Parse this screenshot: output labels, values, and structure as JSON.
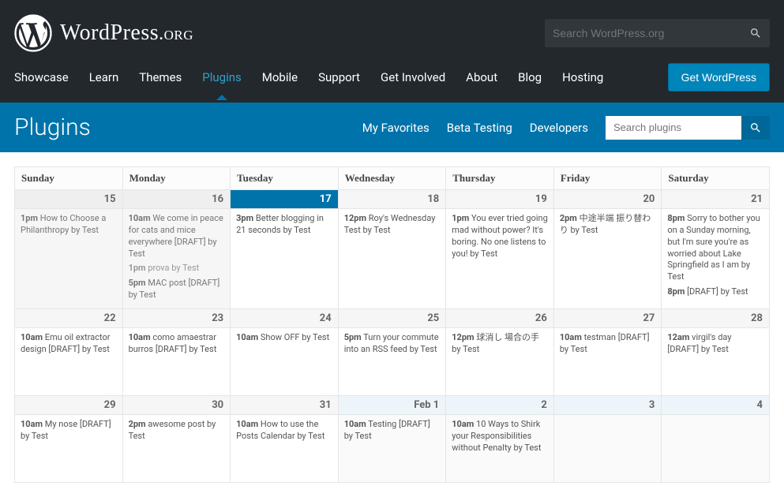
{
  "header": {
    "site_name": "WordPress",
    "site_tld": ".org",
    "search_placeholder": "Search WordPress.org",
    "download_label": "Get WordPress"
  },
  "nav": {
    "items": [
      {
        "label": "Showcase"
      },
      {
        "label": "Learn"
      },
      {
        "label": "Themes"
      },
      {
        "label": "Plugins",
        "active": true
      },
      {
        "label": "Mobile"
      },
      {
        "label": "Support"
      },
      {
        "label": "Get Involved"
      },
      {
        "label": "About"
      },
      {
        "label": "Blog"
      },
      {
        "label": "Hosting"
      }
    ]
  },
  "subheader": {
    "title": "Plugins",
    "links": [
      "My Favorites",
      "Beta Testing",
      "Developers"
    ],
    "search_placeholder": "Search plugins"
  },
  "calendar": {
    "day_headers": [
      "Sunday",
      "Monday",
      "Tuesday",
      "Wednesday",
      "Thursday",
      "Friday",
      "Saturday"
    ],
    "weeks": [
      [
        {
          "num": "15",
          "past": true,
          "events": [
            {
              "t": "1pm",
              "txt": "How to Choose a Philanthropy by Test"
            }
          ]
        },
        {
          "num": "16",
          "past": true,
          "events": [
            {
              "t": "10am",
              "txt": "We come in peace for cats and mice everywhere [DRAFT] by Test"
            },
            {
              "t": "1pm",
              "txt": "prova by Test",
              "dim": true
            },
            {
              "t": "5pm",
              "txt": "MAC post [DRAFT] by Test"
            }
          ]
        },
        {
          "num": "17",
          "today": true,
          "events": [
            {
              "t": "3pm",
              "txt": "Better blogging in 21 seconds by Test"
            }
          ]
        },
        {
          "num": "18",
          "events": [
            {
              "t": "12pm",
              "txt": "Roy's Wednesday Test by Test"
            }
          ]
        },
        {
          "num": "19",
          "events": [
            {
              "t": "1pm",
              "txt": "You ever tried going mad without power? It's boring. No one listens to you! by Test"
            }
          ]
        },
        {
          "num": "20",
          "events": [
            {
              "t": "2pm",
              "txt": "中途半端 振り替わり by Test"
            }
          ]
        },
        {
          "num": "21",
          "events": [
            {
              "t": "8pm",
              "txt": "Sorry to bother you on a Sunday morning, but I'm sure you're as worried about Lake Springfield as I am by Test"
            },
            {
              "t": "8pm",
              "txt": "[DRAFT] by Test"
            }
          ]
        }
      ],
      [
        {
          "num": "22",
          "events": [
            {
              "t": "10am",
              "txt": "Emu oil extractor design [DRAFT] by Test"
            }
          ]
        },
        {
          "num": "23",
          "events": [
            {
              "t": "10am",
              "txt": "como amaestrar burros [DRAFT] by Test"
            }
          ]
        },
        {
          "num": "24",
          "events": [
            {
              "t": "10am",
              "txt": "Show OFF by Test"
            }
          ]
        },
        {
          "num": "25",
          "events": [
            {
              "t": "5pm",
              "txt": "Turn your commute into an RSS feed by Test"
            }
          ]
        },
        {
          "num": "26",
          "events": [
            {
              "t": "12pm",
              "txt": "球消し 場合の手 by Test"
            }
          ]
        },
        {
          "num": "27",
          "events": [
            {
              "t": "10am",
              "txt": "testman [DRAFT] by Test"
            }
          ]
        },
        {
          "num": "28",
          "events": [
            {
              "t": "12am",
              "txt": "virgil's day [DRAFT] by Test"
            }
          ]
        }
      ],
      [
        {
          "num": "29",
          "events": [
            {
              "t": "10am",
              "txt": "My nose [DRAFT] by Test"
            }
          ]
        },
        {
          "num": "30",
          "events": [
            {
              "t": "2pm",
              "txt": "awesome post by Test"
            }
          ]
        },
        {
          "num": "31",
          "events": [
            {
              "t": "10am",
              "txt": "How to use the Posts Calendar by Test"
            }
          ]
        },
        {
          "num": "Feb 1",
          "othermonth": true,
          "events": [
            {
              "t": "10am",
              "txt": "Testing [DRAFT] by Test"
            }
          ]
        },
        {
          "num": "2",
          "othermonth": true,
          "events": [
            {
              "t": "10am",
              "txt": "10 Ways to Shirk your Responsibilities without Penalty by Test"
            }
          ]
        },
        {
          "num": "3",
          "othermonth": true,
          "events": []
        },
        {
          "num": "4",
          "othermonth": true,
          "events": []
        }
      ]
    ]
  }
}
